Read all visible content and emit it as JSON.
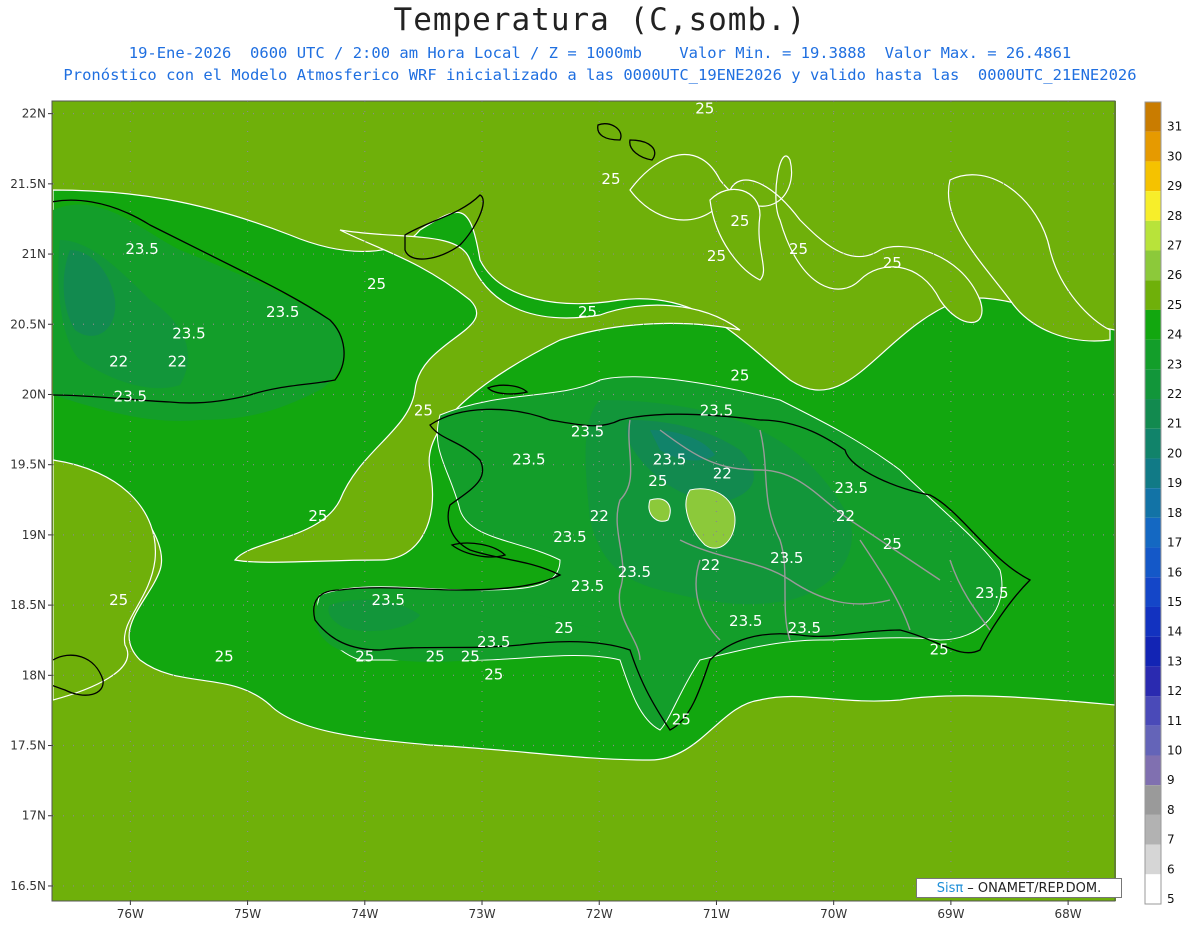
{
  "header": {
    "title": "Temperatura (C,somb.)",
    "line1": "19-Ene-2026  0600 UTC / 2:00 am Hora Local / Z = 1000mb    Valor Min. = 19.3888  Valor Max. = 26.4861",
    "line2": "Pronóstico con el Modelo Atmosferico WRF inicializado a las 0000UTC_19ENE2026 y valido hasta las  0000UTC_21ENE2026"
  },
  "axes": {
    "lat_labels": [
      "22N",
      "21.5N",
      "21N",
      "20.5N",
      "20N",
      "19.5N",
      "19N",
      "18.5N",
      "18N",
      "17.5N",
      "17N",
      "16.5N"
    ],
    "lon_labels": [
      "76W",
      "75W",
      "74W",
      "73W",
      "72W",
      "71W",
      "70W",
      "69W",
      "68W"
    ]
  },
  "colorbar": {
    "labels": [
      "31",
      "30",
      "29",
      "28",
      "27",
      "26",
      "25",
      "24",
      "23",
      "22",
      "21",
      "20",
      "19",
      "18",
      "17",
      "16",
      "15",
      "14",
      "13",
      "12",
      "11",
      "10",
      "9",
      "8",
      "7",
      "6",
      "5"
    ],
    "colors": [
      "#c97c00",
      "#e69a00",
      "#f5c200",
      "#f7ee2a",
      "#b8e33a",
      "#8cc93a",
      "#6fb00a",
      "#12a70f",
      "#139e2a",
      "#12963a",
      "#128a4f",
      "#11836a",
      "#117a86",
      "#1273a6",
      "#1468c2",
      "#1458c8",
      "#1446c8",
      "#1232c0",
      "#1224b4",
      "#2a2ab0",
      "#4a4ab8",
      "#6464b8",
      "#8070b0",
      "#9a9a9a",
      "#b2b2b2",
      "#d6d6d6",
      "#ffffff"
    ]
  },
  "contour_labels": [
    {
      "text": "25",
      "lon": -71.1,
      "lat": 22.0
    },
    {
      "text": "25",
      "lon": -71.9,
      "lat": 21.5
    },
    {
      "text": "25",
      "lon": -70.8,
      "lat": 21.2
    },
    {
      "text": "25",
      "lon": -71.0,
      "lat": 20.95
    },
    {
      "text": "25",
      "lon": -70.3,
      "lat": 21.0
    },
    {
      "text": "25",
      "lon": -69.5,
      "lat": 20.9
    },
    {
      "text": "25",
      "lon": -73.9,
      "lat": 20.75
    },
    {
      "text": "25",
      "lon": -72.1,
      "lat": 20.55
    },
    {
      "text": "25",
      "lon": -70.8,
      "lat": 20.1
    },
    {
      "text": "25",
      "lon": -73.5,
      "lat": 19.85
    },
    {
      "text": "25",
      "lon": -74.4,
      "lat": 19.1
    },
    {
      "text": "25",
      "lon": -76.1,
      "lat": 18.5
    },
    {
      "text": "25",
      "lon": -75.2,
      "lat": 18.1
    },
    {
      "text": "25",
      "lon": -74.0,
      "lat": 18.1
    },
    {
      "text": "25",
      "lon": -73.4,
      "lat": 18.1
    },
    {
      "text": "25",
      "lon": -73.1,
      "lat": 18.1
    },
    {
      "text": "25",
      "lon": -72.9,
      "lat": 17.97
    },
    {
      "text": "25",
      "lon": -72.3,
      "lat": 18.3
    },
    {
      "text": "25",
      "lon": -71.3,
      "lat": 17.65
    },
    {
      "text": "25",
      "lon": -69.5,
      "lat": 18.9
    },
    {
      "text": "25",
      "lon": -69.1,
      "lat": 18.15
    },
    {
      "text": "23.5",
      "lon": -75.9,
      "lat": 21.0
    },
    {
      "text": "23.5",
      "lon": -74.7,
      "lat": 20.55
    },
    {
      "text": "23.5",
      "lon": -75.5,
      "lat": 20.4
    },
    {
      "text": "23.5",
      "lon": -76.0,
      "lat": 19.95
    },
    {
      "text": "22",
      "lon": -76.1,
      "lat": 20.2
    },
    {
      "text": "22",
      "lon": -75.6,
      "lat": 20.2
    },
    {
      "text": "23.5",
      "lon": -72.1,
      "lat": 19.7
    },
    {
      "text": "23.5",
      "lon": -72.6,
      "lat": 19.5
    },
    {
      "text": "23.5",
      "lon": -71.4,
      "lat": 19.5
    },
    {
      "text": "23.5",
      "lon": -71.0,
      "lat": 19.85
    },
    {
      "text": "25",
      "lon": -71.5,
      "lat": 19.35
    },
    {
      "text": "22",
      "lon": -70.95,
      "lat": 19.4
    },
    {
      "text": "22",
      "lon": -72.0,
      "lat": 19.1
    },
    {
      "text": "23.5",
      "lon": -72.25,
      "lat": 18.95
    },
    {
      "text": "23.5",
      "lon": -69.85,
      "lat": 19.3
    },
    {
      "text": "22",
      "lon": -69.9,
      "lat": 19.1
    },
    {
      "text": "23.5",
      "lon": -70.4,
      "lat": 18.8
    },
    {
      "text": "22",
      "lon": -71.05,
      "lat": 18.75
    },
    {
      "text": "23.5",
      "lon": -71.7,
      "lat": 18.7
    },
    {
      "text": "23.5",
      "lon": -72.1,
      "lat": 18.6
    },
    {
      "text": "23.5",
      "lon": -73.8,
      "lat": 18.5
    },
    {
      "text": "23.5",
      "lon": -72.9,
      "lat": 18.2
    },
    {
      "text": "23.5",
      "lon": -70.75,
      "lat": 18.35
    },
    {
      "text": "23.5",
      "lon": -70.25,
      "lat": 18.3
    },
    {
      "text": "23.5",
      "lon": -68.65,
      "lat": 18.55
    }
  ],
  "credit": {
    "logo": "Sisπ",
    "text": "– ONAMET/REP.DOM."
  }
}
